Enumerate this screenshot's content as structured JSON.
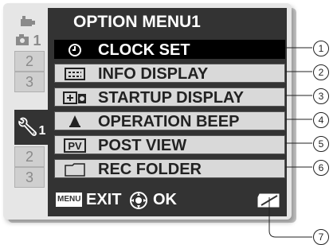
{
  "menu": {
    "title": "OPTION MENU1",
    "items": [
      {
        "label": "CLOCK SET",
        "icon": "clock-icon",
        "selected": true
      },
      {
        "label": "INFO DISPLAY",
        "icon": "info-display-icon",
        "selected": false
      },
      {
        "label": "STARTUP DISPLAY",
        "icon": "startup-display-icon",
        "selected": false
      },
      {
        "label": "OPERATION BEEP",
        "icon": "bell-icon",
        "selected": false
      },
      {
        "label": "POST VIEW",
        "icon": "pv-icon",
        "selected": false
      },
      {
        "label": "REC FOLDER",
        "icon": "folder-icon",
        "selected": false
      }
    ]
  },
  "tabs": {
    "cam1": "1",
    "cam2": "2",
    "cam3": "3",
    "opt1": "1",
    "opt2": "2",
    "opt3": "3"
  },
  "bottom": {
    "menu_key": "MENU",
    "exit_label": "EXIT",
    "ok_label": "OK"
  },
  "callouts": [
    "1",
    "2",
    "3",
    "4",
    "5",
    "6",
    "7"
  ]
}
